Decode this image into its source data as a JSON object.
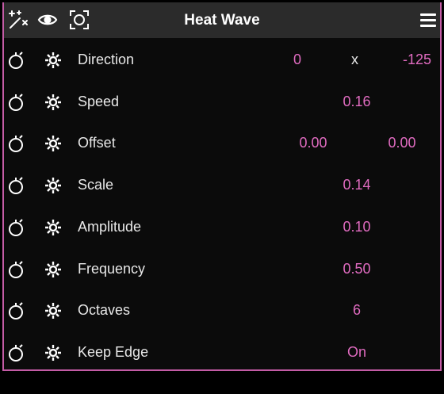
{
  "header": {
    "title": "Heat Wave",
    "icons": [
      "magic-wand-icon",
      "eye-icon",
      "target-icon",
      "menu-icon"
    ]
  },
  "rows": [
    {
      "label": "Direction",
      "values": [
        "0",
        "-125"
      ],
      "separator": "x"
    },
    {
      "label": "Speed",
      "value": "0.16"
    },
    {
      "label": "Offset",
      "values": [
        "0.00",
        "0.00"
      ]
    },
    {
      "label": "Scale",
      "value": "0.14"
    },
    {
      "label": "Amplitude",
      "value": "0.10"
    },
    {
      "label": "Frequency",
      "value": "0.50"
    },
    {
      "label": "Octaves",
      "value": "6"
    },
    {
      "label": "Keep Edge",
      "value": "On"
    }
  ],
  "colors": {
    "accent": "#e06bc0",
    "header_bg": "#2b2b2b",
    "border": "#c45ca6"
  }
}
